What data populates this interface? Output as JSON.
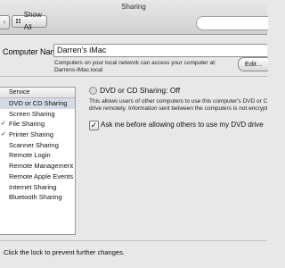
{
  "window": {
    "title": "Sharing"
  },
  "toolbar": {
    "show_all_label": "Show All",
    "forward_icon": "chevron-right-icon",
    "show_all_icon": "grid-icon"
  },
  "computer_name": {
    "label": "Computer Name:",
    "value": "Darren's iMac",
    "note_line1": "Computers on your local network can access your computer at:",
    "note_line2": "Darrens-iMac.local",
    "edit_label": "Edit..."
  },
  "services": {
    "header": "Service",
    "items": [
      {
        "label": "DVD or CD Sharing",
        "selected": true
      },
      {
        "label": "Screen Sharing"
      },
      {
        "label": "File Sharing"
      },
      {
        "label": "Printer Sharing"
      },
      {
        "label": "Scanner Sharing"
      },
      {
        "label": "Remote Login"
      },
      {
        "label": "Remote Management"
      },
      {
        "label": "Remote Apple Events"
      },
      {
        "label": "Internet Sharing"
      },
      {
        "label": "Bluetooth Sharing"
      }
    ]
  },
  "detail": {
    "status": "DVD or CD Sharing: Off",
    "desc_line1": "This allows users of other computers to use this computer's DVD or CD",
    "desc_line2": "drive remotely. Information sent between the computers is not encrypte",
    "ask_label": "Ask me before allowing others to use my DVD drive",
    "ask_checked": true
  },
  "footer": {
    "lock_text": "Click the lock to prevent further changes."
  },
  "colors": {
    "selection": "#d4dbe5",
    "window_bg": "#e8e8e8"
  }
}
